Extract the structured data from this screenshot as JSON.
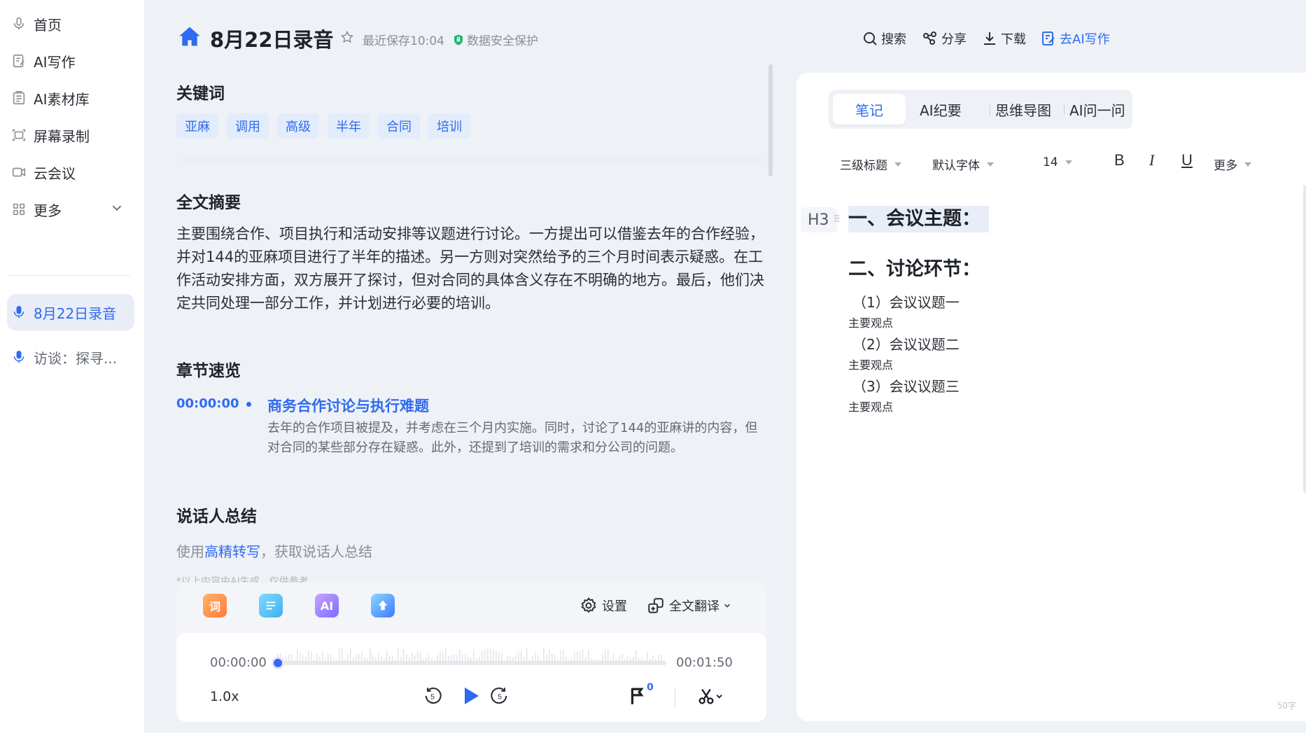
{
  "sidebar": {
    "items": [
      {
        "label": "首页",
        "icon": "microphone-icon"
      },
      {
        "label": "AI写作",
        "icon": "edit-doc-icon"
      },
      {
        "label": "AI素材库",
        "icon": "library-icon"
      },
      {
        "label": "屏幕录制",
        "icon": "screen-record-icon"
      },
      {
        "label": "云会议",
        "icon": "video-icon"
      },
      {
        "label": "更多",
        "icon": "grid-icon"
      }
    ],
    "recordings": [
      {
        "label": "8月22日录音",
        "active": true
      },
      {
        "label": "访谈：探寻...",
        "active": false
      }
    ]
  },
  "header": {
    "title": "8月22日录音",
    "saved": "最近保存10:04",
    "secure": "数据安全保护",
    "actions": {
      "search": "搜索",
      "share": "分享",
      "download": "下载",
      "ai_write": "去AI写作"
    }
  },
  "keywords": {
    "title": "关键词",
    "tags": [
      "亚麻",
      "调用",
      "高级",
      "半年",
      "合同",
      "培训"
    ]
  },
  "summary": {
    "title": "全文摘要",
    "text": "主要围绕合作、项目执行和活动安排等议题进行讨论。一方提出可以借鉴去年的合作经验，并对144的亚麻项目进行了半年的描述。另一方则对突然给予的三个月时间表示疑惑。在工作活动安排方面，双方展开了探讨，但对合同的具体含义存在不明确的地方。最后，他们决定共同处理一部分工作，并计划进行必要的培训。"
  },
  "chapters": {
    "title": "章节速览",
    "items": [
      {
        "time": "00:00:00",
        "title": "商务合作讨论与执行难题",
        "desc": "去年的合作项目被提及，并考虑在三个月内实施。同时，讨论了144的亚麻讲的内容，但对合同的某些部分存在疑惑。此外，还提到了培训的需求和分公司的问题。"
      }
    ]
  },
  "speakers": {
    "title": "说话人总结",
    "hint_prefix": "使用",
    "hint_link": "高精转写",
    "hint_suffix": "，获取说话人总结",
    "ai_note": "*以上内容由AI生成，仅供参考"
  },
  "player": {
    "tools": [
      "词",
      "",
      "AI",
      ""
    ],
    "settings": "设置",
    "translate": "全文翻译",
    "current_time": "00:00:00",
    "total_time": "00:01:50",
    "speed": "1.0x",
    "rewind_seconds": "5",
    "forward_seconds": "5",
    "flag_count": "0",
    "progress": 0
  },
  "notes": {
    "tabs": [
      "笔记",
      "AI纪要",
      "思维导图",
      "AI问一问"
    ],
    "active_tab": "笔记",
    "format": {
      "heading": "三级标题",
      "font": "默认字体",
      "size": "14",
      "bold": "B",
      "italic": "I",
      "underline": "U",
      "more": "更多"
    },
    "h3_badge": "H3",
    "heading1": "一、会议主题：",
    "heading2": "二、讨论环节：",
    "items": [
      {
        "topic": "（1）会议议题一",
        "sub": "主要观点"
      },
      {
        "topic": "（2）会议议题二",
        "sub": "主要观点"
      },
      {
        "topic": "（3）会议议题三",
        "sub": "主要观点"
      }
    ],
    "word_count": "50字"
  },
  "colors": {
    "accent": "#2f6bf0",
    "background": "#eef1f6",
    "tag_bg": "#e3ecfb"
  }
}
